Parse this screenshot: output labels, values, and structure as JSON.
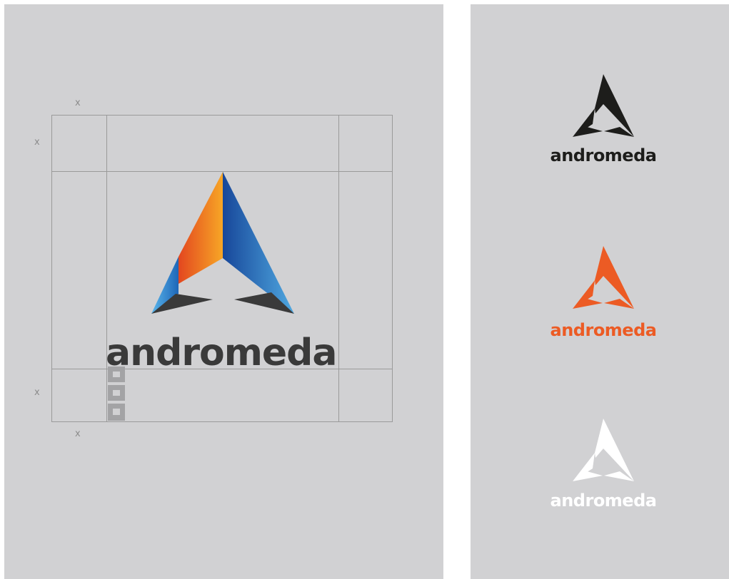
{
  "construction": {
    "wordmark": "andromeda",
    "clearance_label_top": "x",
    "clearance_label_left_top": "x",
    "clearance_label_left_bottom": "x",
    "clearance_label_bottom": "x"
  },
  "variants": {
    "black": {
      "wordmark": "andromeda",
      "color": "#1d1d1b"
    },
    "orange": {
      "wordmark": "andromeda",
      "color": "#ec5b24"
    },
    "white": {
      "wordmark": "andromeda",
      "color": "#ffffff"
    }
  },
  "colors": {
    "panel_background": "#d1d1d3",
    "guide_lines": "#9a9a9a",
    "logo_orange": "#f39322",
    "logo_blue": "#1d5fae",
    "logo_base": "#3a3a3a"
  },
  "icons": [
    "andromeda-logo-mark-icon"
  ]
}
